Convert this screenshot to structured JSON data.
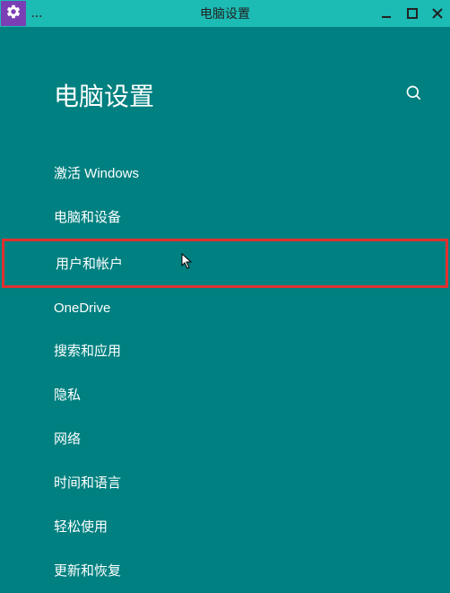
{
  "titlebar": {
    "title": "电脑设置",
    "dots": "..."
  },
  "header": {
    "page_title": "电脑设置"
  },
  "nav": {
    "items": [
      {
        "label": "激活 Windows",
        "highlighted": false
      },
      {
        "label": "电脑和设备",
        "highlighted": false
      },
      {
        "label": "用户和帐户",
        "highlighted": true
      },
      {
        "label": "OneDrive",
        "highlighted": false
      },
      {
        "label": "搜索和应用",
        "highlighted": false
      },
      {
        "label": "隐私",
        "highlighted": false
      },
      {
        "label": "网络",
        "highlighted": false
      },
      {
        "label": "时间和语言",
        "highlighted": false
      },
      {
        "label": "轻松使用",
        "highlighted": false
      },
      {
        "label": "更新和恢复",
        "highlighted": false
      }
    ]
  }
}
